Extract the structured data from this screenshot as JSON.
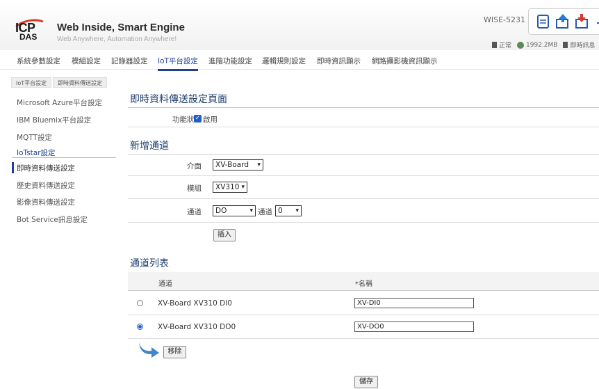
{
  "brand": {
    "logo_top": "ICP",
    "logo_bottom": "DAS",
    "title": "Web Inside, Smart Engine",
    "subtitle": "Web Anywhere, Automation Anywhere!"
  },
  "model": "WISE-5231",
  "toolbar": {
    "icons": [
      "document-icon",
      "upload-icon",
      "download-icon",
      "logout-icon"
    ]
  },
  "status": {
    "state": "正常",
    "memory": "1992.2MB",
    "info": "即時訊息"
  },
  "nav": [
    "系統參數設定",
    "模組設定",
    "記錄器設定",
    "IoT平台設定",
    "進階功能設定",
    "邏輯規則設定",
    "即時資訊顯示",
    "網路攝影機資訊顯示"
  ],
  "breadcrumb": [
    "IoT平台設定",
    "即時資料傳送設定"
  ],
  "sidebar": [
    "Microsoft Azure平台設定",
    "IBM Bluemix平台設定",
    "MQTT設定",
    "IoTstar設定",
    "即時資料傳送設定",
    "歷史資料傳送設定",
    "影像資料傳送設定",
    "Bot Service訊息設定"
  ],
  "page": {
    "title": "即時資料傳送設定頁面",
    "function_label": "功能狀態",
    "function_checkbox_label": "啟用",
    "add_section": "新增通道",
    "interface_label": "介面",
    "interface_value": "XV-Board",
    "module_label": "模組",
    "module_value": "XV310",
    "channel_label": "通道",
    "channel_type_value": "DO",
    "channel_inline_label": "通道",
    "channel_num_value": "0",
    "insert_button": "插入",
    "list_section": "通道列表",
    "col_channel": "通道",
    "col_name": "*名稱",
    "rows": [
      {
        "channel": "XV-Board XV310 DI0",
        "name": "XV-DI0",
        "selected": false
      },
      {
        "channel": "XV-Board XV310 DO0",
        "name": "XV-DO0",
        "selected": true
      }
    ],
    "remove_button": "移除",
    "save_button": "儲存"
  },
  "colors": {
    "accent": "#1f3f8f",
    "logo_red": "#d63a2a"
  }
}
